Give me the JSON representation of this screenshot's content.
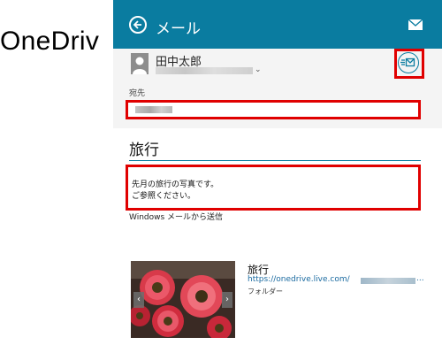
{
  "app": {
    "title": "OneDriv"
  },
  "header": {
    "title": "メール"
  },
  "sender": {
    "name": "田中太郎"
  },
  "to": {
    "label": "宛先"
  },
  "message": {
    "subject": "旅行",
    "body_lines": [
      "先月の旅行の写真です。",
      "ご参照ください。"
    ],
    "signature": "Windows メールから送信"
  },
  "attachment": {
    "title": "旅行",
    "url": "https://onedrive.live.com/",
    "url_more": "...",
    "type": "フォルダー"
  },
  "colors": {
    "accent": "#0a7ca0",
    "highlight": "#e00000"
  }
}
